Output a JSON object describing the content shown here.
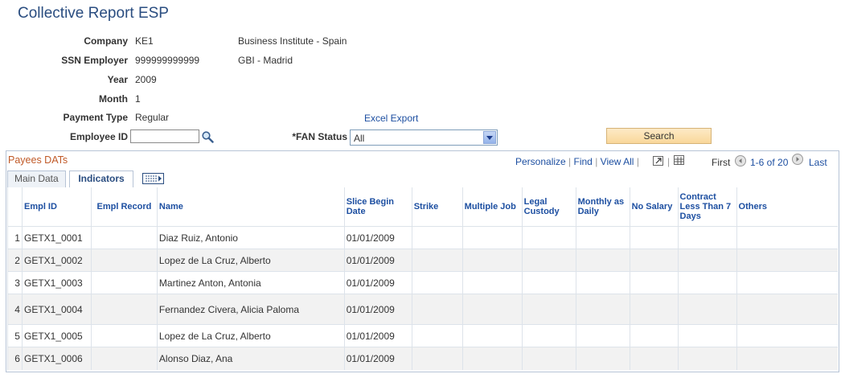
{
  "page": {
    "title": "Collective Report ESP"
  },
  "fields": {
    "company_label": "Company",
    "company_value": "KE1",
    "company_name": "Business Institute - Spain",
    "ssn_label": "SSN Employer",
    "ssn_value": "999999999999",
    "ssn_name": "GBI - Madrid",
    "year_label": "Year",
    "year_value": "2009",
    "month_label": "Month",
    "month_value": "1",
    "payment_label": "Payment Type",
    "payment_value": "Regular",
    "excel_export": "Excel Export",
    "employee_label": "Employee ID",
    "employee_value": "",
    "fan_label": "*FAN Status",
    "fan_value": "All",
    "search_button": "Search"
  },
  "grid": {
    "title": "Payees DATs",
    "personalize": "Personalize",
    "find": "Find",
    "view_all": "View All",
    "first": "First",
    "range": "1-6 of 20",
    "last": "Last",
    "tabs": {
      "main": "Main Data",
      "indicators": "Indicators"
    },
    "columns": [
      "Empl ID",
      "Empl Record",
      "Name",
      "Slice Begin Date",
      "Strike",
      "Multiple Job",
      "Legal Custody",
      "Monthly as Daily",
      "No Salary",
      "Contract Less Than 7 Days",
      "Others"
    ],
    "rows": [
      {
        "n": "1",
        "id": "GETX1_0001",
        "rec": "",
        "name": "Diaz Ruiz, Antonio",
        "date": "01/01/2009"
      },
      {
        "n": "2",
        "id": "GETX1_0002",
        "rec": "",
        "name": "Lopez de La Cruz, Alberto",
        "date": "01/01/2009"
      },
      {
        "n": "3",
        "id": "GETX1_0003",
        "rec": "",
        "name": "Martinez Anton, Antonia",
        "date": "01/01/2009"
      },
      {
        "n": "4",
        "id": "GETX1_0004",
        "rec": "",
        "name": "Fernandez Civera, Alicia Paloma",
        "date": "01/01/2009"
      },
      {
        "n": "5",
        "id": "GETX1_0005",
        "rec": "",
        "name": "Lopez de La Cruz, Alberto",
        "date": "01/01/2009"
      },
      {
        "n": "6",
        "id": "GETX1_0006",
        "rec": "",
        "name": "Alonso Diaz, Ana",
        "date": "01/01/2009"
      }
    ]
  }
}
